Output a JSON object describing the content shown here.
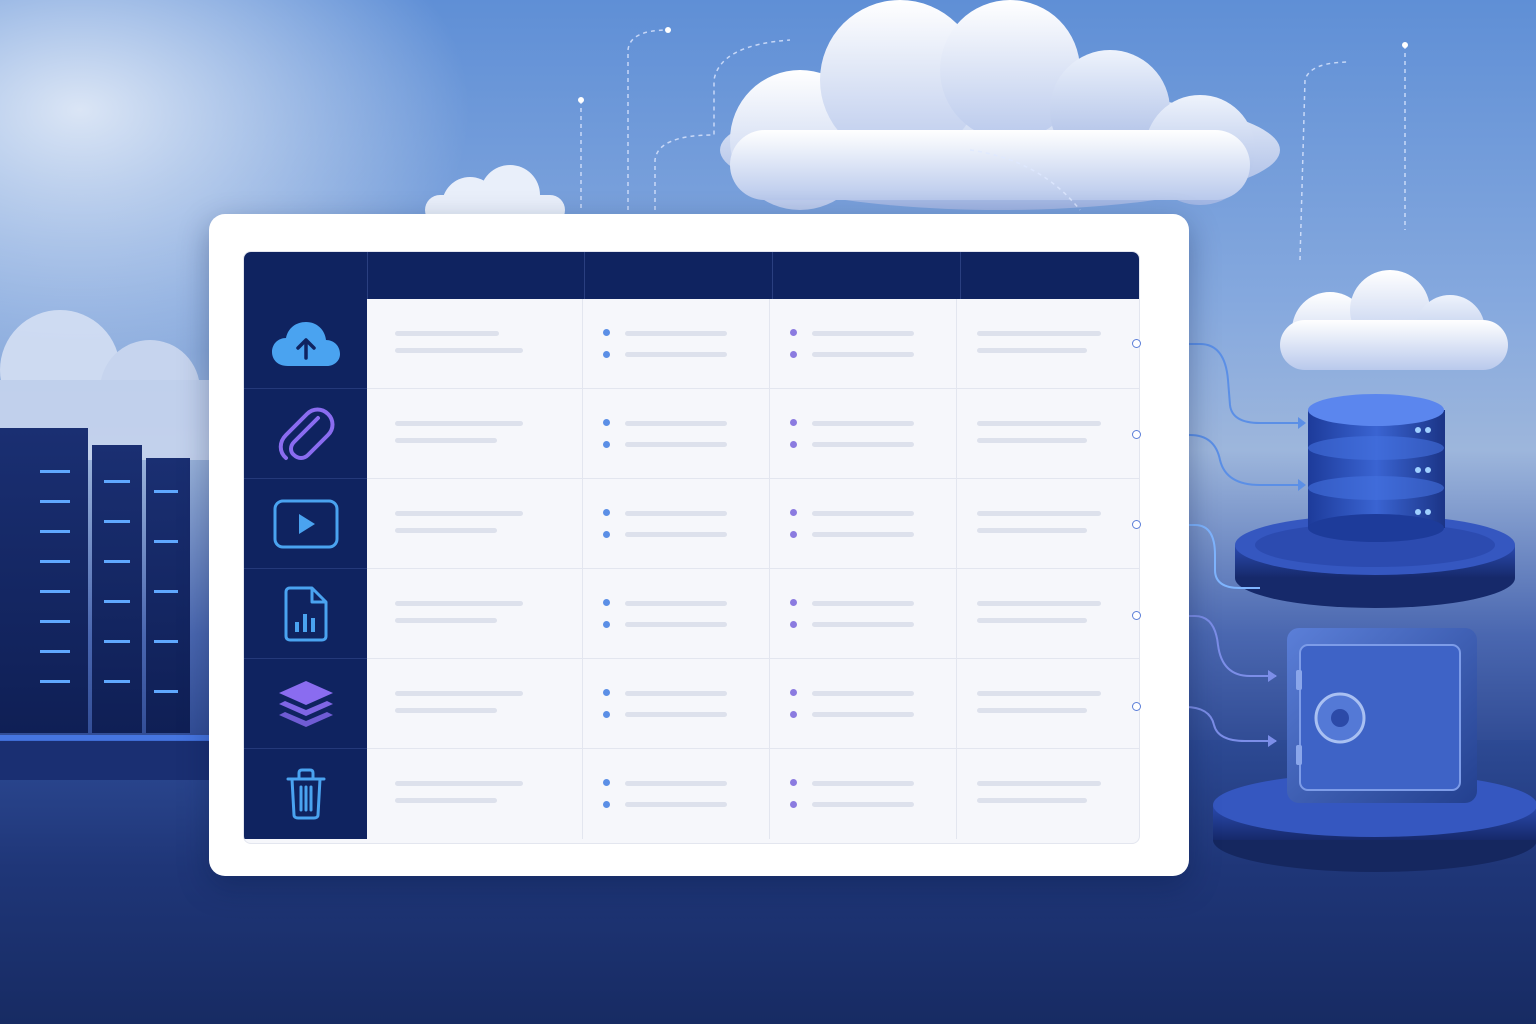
{
  "scene": {
    "colors": {
      "header": "#0f2360",
      "icon_blue": "#4aa3f0",
      "icon_violet": "#8a6cf0",
      "dot_blue": "#5b8fe6",
      "dot_violet": "#8b7be0",
      "connector": "#5b7ed8"
    }
  },
  "table": {
    "header_cells": [
      "",
      "",
      "",
      "",
      ""
    ],
    "rows": [
      {
        "icon": "cloud-upload-icon"
      },
      {
        "icon": "paperclip-icon"
      },
      {
        "icon": "video-play-icon"
      },
      {
        "icon": "file-chart-icon"
      },
      {
        "icon": "layers-icon"
      },
      {
        "icon": "trash-icon"
      }
    ]
  },
  "illustration": {
    "objects": [
      "server-racks",
      "clouds",
      "database-stack",
      "vault-safe"
    ]
  }
}
